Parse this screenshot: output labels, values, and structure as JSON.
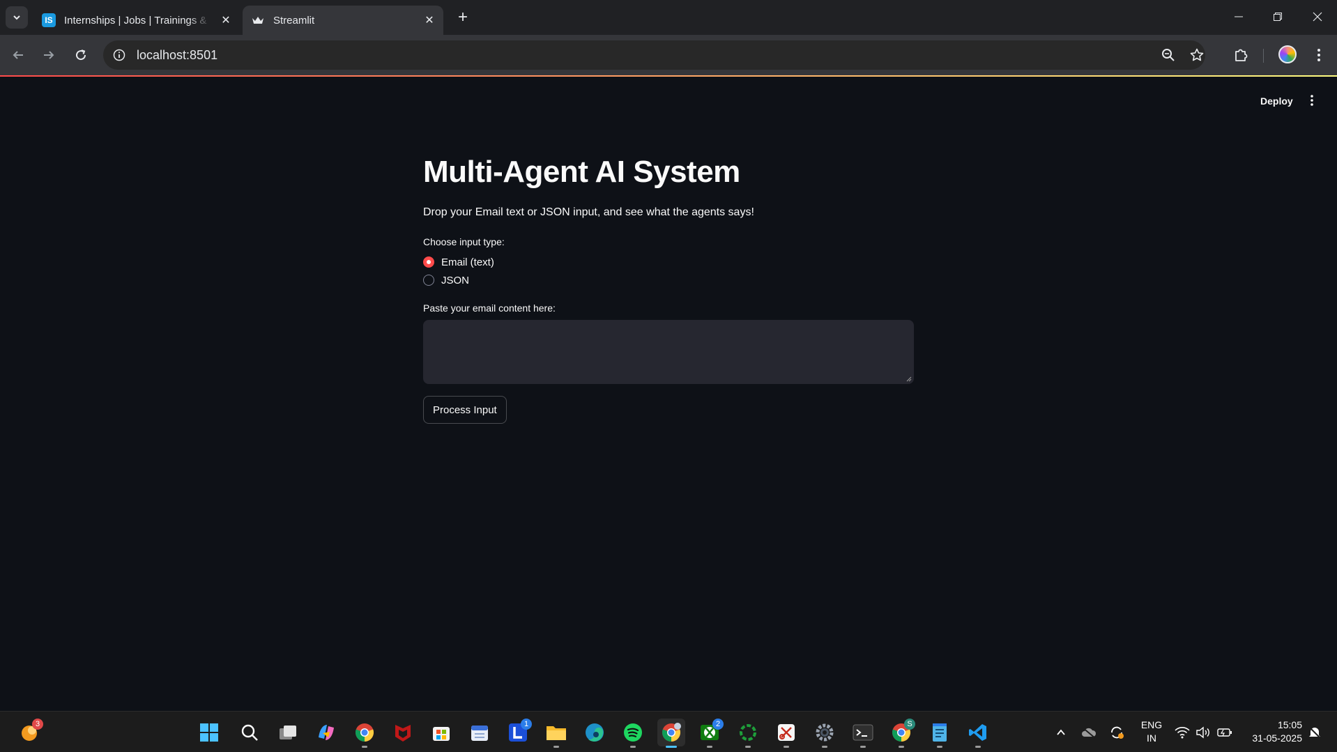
{
  "browser": {
    "tabs": [
      {
        "title": "Internships | Jobs | Trainings & Placements | Internshala",
        "favicon": "internshala-icon",
        "active": false
      },
      {
        "title": "Streamlit",
        "favicon": "streamlit-crown-icon",
        "active": true
      }
    ],
    "url": "localhost:8501",
    "colors": {
      "tab_bar": "#202124",
      "toolbar": "#35363a",
      "omnibox": "#282828"
    }
  },
  "app": {
    "header": {
      "deploy_label": "Deploy"
    },
    "title": "Multi-Agent AI System",
    "description": "Drop your Email text or JSON input, and see what the agents says!",
    "input_type": {
      "label": "Choose input type:",
      "options": [
        "Email (text)",
        "JSON"
      ],
      "selected": "Email (text)"
    },
    "email_input": {
      "label": "Paste your email content here:",
      "value": ""
    },
    "process_button": "Process Input",
    "colors": {
      "background": "#0e1117",
      "accent": "#ff4b4b",
      "input_bg": "#262730",
      "text": "#fafafa"
    }
  },
  "taskbar": {
    "pinned": [
      {
        "name": "windows-start-icon"
      },
      {
        "name": "search-icon"
      },
      {
        "name": "task-view-icon"
      },
      {
        "name": "copilot-icon"
      },
      {
        "name": "chrome-icon"
      },
      {
        "name": "mcafee-icon"
      },
      {
        "name": "microsoft-store-icon"
      },
      {
        "name": "calendar-app-icon"
      },
      {
        "name": "lens-app-icon",
        "badge": "1"
      },
      {
        "name": "file-explorer-icon"
      },
      {
        "name": "edge-icon"
      },
      {
        "name": "spotify-icon"
      },
      {
        "name": "chrome-profile-icon"
      },
      {
        "name": "xbox-icon",
        "badge": "2"
      },
      {
        "name": "loading-ring-app-icon"
      },
      {
        "name": "snipping-tool-icon"
      },
      {
        "name": "settings-icon"
      },
      {
        "name": "terminal-icon"
      },
      {
        "name": "chrome-profile-s-icon",
        "badge": "S"
      },
      {
        "name": "notepad-icon"
      },
      {
        "name": "vscode-icon"
      }
    ],
    "widgets_badge": "3",
    "language": {
      "line1": "ENG",
      "line2": "IN"
    },
    "time": "15:05",
    "date": "31-05-2025"
  }
}
